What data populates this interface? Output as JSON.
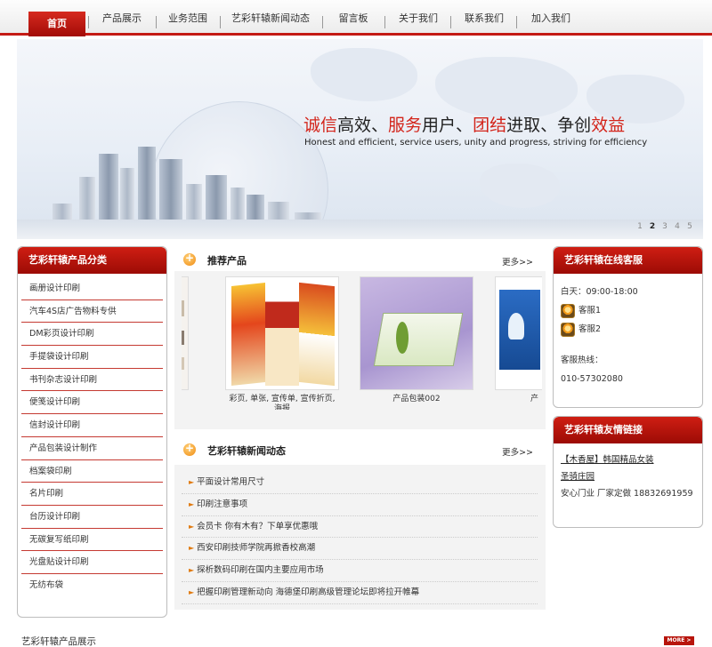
{
  "nav": {
    "items": [
      {
        "label": "首页"
      },
      {
        "label": "产品展示"
      },
      {
        "label": "业务范围"
      },
      {
        "label": "艺彩轩辕新闻动态"
      },
      {
        "label": "留言板"
      },
      {
        "label": "关于我们"
      },
      {
        "label": "联系我们"
      },
      {
        "label": "加入我们"
      }
    ]
  },
  "banner": {
    "slogan_parts": [
      "诚信",
      "高效、",
      "服务",
      "用户、",
      "团结",
      "进取、争创",
      "效益"
    ],
    "slogan_en": "Honest and efficient, service users, unity and progress, striving for efficiency",
    "pages": [
      "1",
      "2",
      "3",
      "4",
      "5"
    ],
    "current_page": "2"
  },
  "categories": {
    "title": "艺彩轩辕产品分类",
    "items": [
      "画册设计印刷",
      "汽车4S店广告物料专供",
      "DM彩页设计印刷",
      "手提袋设计印刷",
      "书刊杂志设计印刷",
      "便笺设计印刷",
      "信封设计印刷",
      "产品包装设计制作",
      "档案袋印刷",
      "名片印刷",
      "台历设计印刷",
      "无碳复写纸印刷",
      "光盘贴设计印刷",
      "无纺布袋"
    ]
  },
  "products": {
    "title": "推荐产品",
    "more": "更多>>",
    "items": [
      {
        "caption": "彩页, 单张, 宣传单, 宣传折页, 海报"
      },
      {
        "caption": "产品包装002"
      },
      {
        "caption": "产"
      }
    ]
  },
  "news": {
    "title": "艺彩轩辕新闻动态",
    "more": "更多>>",
    "items": [
      "平面设计常用尺寸",
      "印刷注意事项",
      "会员卡  你有木有？下单享优惠哦",
      "西安印刷技师学院再掀香校高潮",
      "探析数码印刷在国内主要应用市场",
      "把握印刷管理新动向   海德堡印刷高级管理论坛即将拉开帷幕"
    ]
  },
  "service": {
    "title": "艺彩轩辕在线客服",
    "hours": "白天：09:00-18:00",
    "agents": [
      "客服1",
      "客服2"
    ],
    "hotline_label": "客服热线：",
    "hotline": "010-57302080"
  },
  "links": {
    "title": "艺彩轩辕友情链接",
    "items": [
      "【木香屋】韩国精品女装",
      "圣骑庄园"
    ],
    "text": "安心门业  厂家定做 18832691959"
  },
  "footer": {
    "title": "艺彩轩辕产品展示",
    "more": "MORE >"
  },
  "colors": {
    "accent": "#c41a14",
    "icon_orange": "#f08a10"
  }
}
